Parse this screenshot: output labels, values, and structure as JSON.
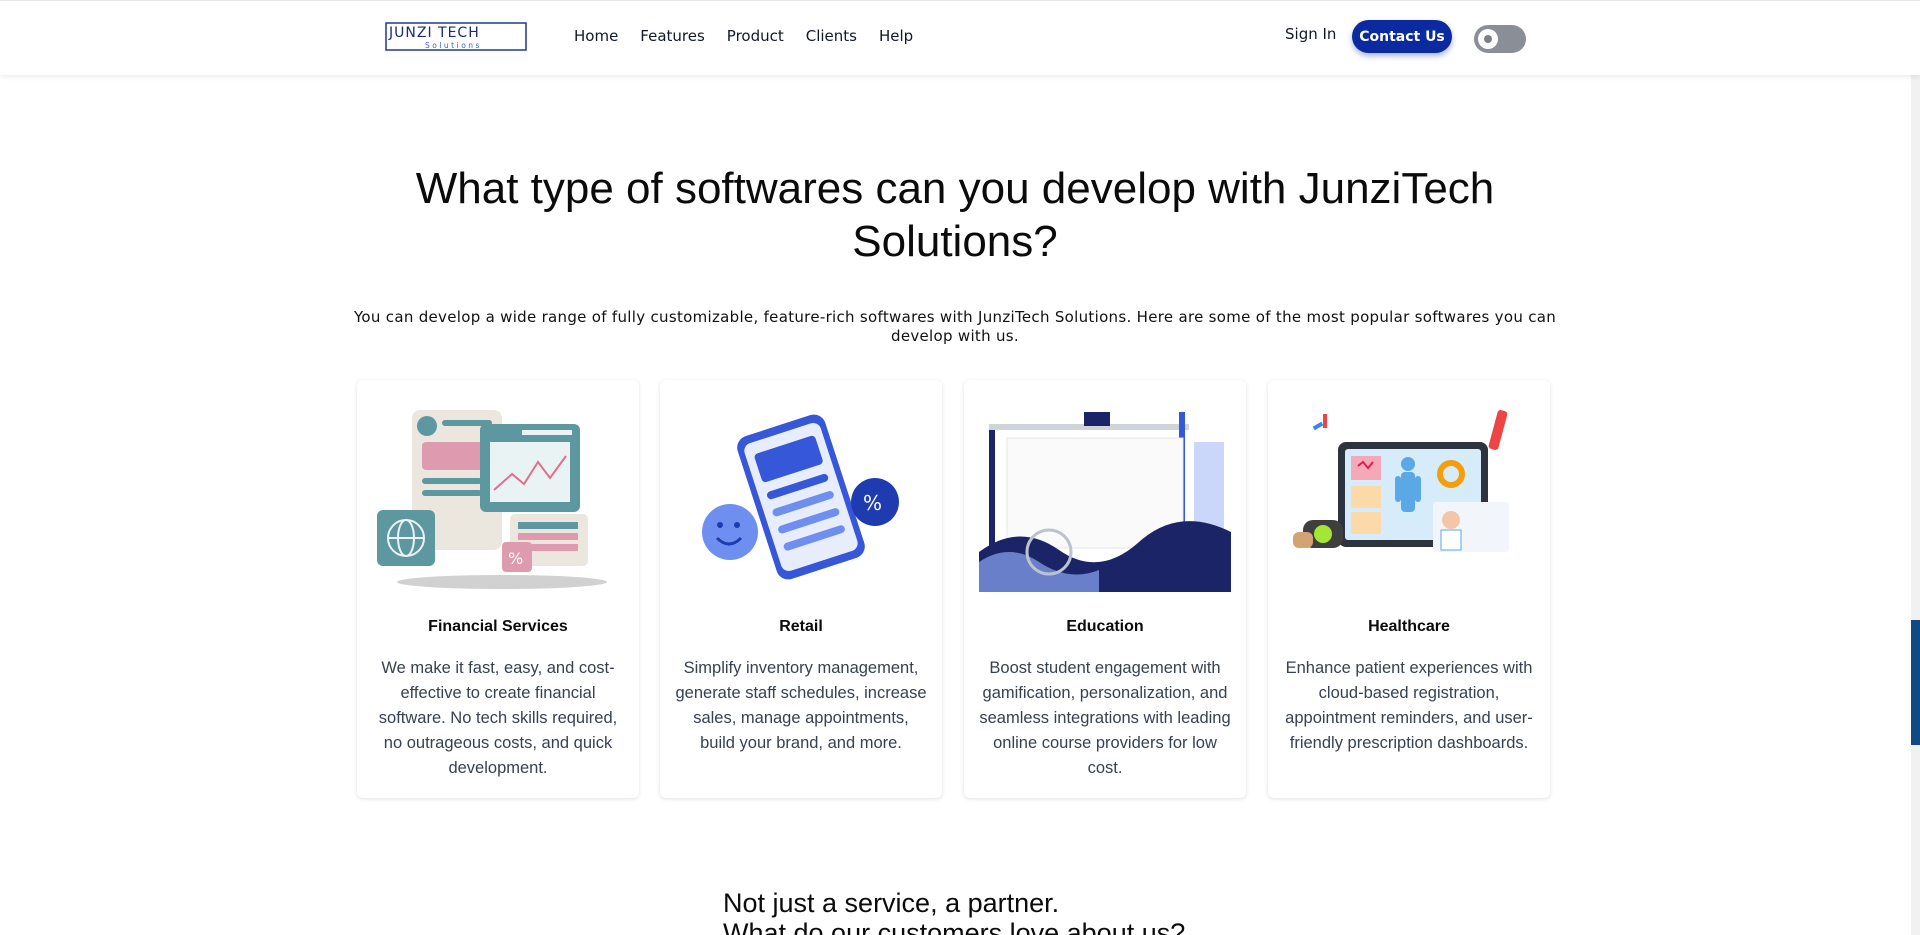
{
  "header": {
    "logo_text": "JUNZI TECH",
    "logo_subtext": "Solutions",
    "nav": [
      "Home",
      "Features",
      "Product",
      "Clients",
      "Help"
    ],
    "sign_in": "Sign In",
    "contact": "Contact Us"
  },
  "hero": {
    "title": "What type of softwares can you develop with JunziTech Solutions?",
    "subtitle": "You can develop a wide range of fully customizable, feature-rich softwares with JunziTech Solutions. Here are some of the most popular softwares you can develop with us."
  },
  "cards": [
    {
      "title": "Financial Services",
      "description": "We make it fast, easy, and cost-effective to create financial software. No tech skills required, no outrageous costs, and quick development."
    },
    {
      "title": "Retail",
      "description": "Simplify inventory management, generate staff schedules, increase sales, manage appointments, build your brand, and more."
    },
    {
      "title": "Education",
      "description": "Boost student engagement with gamification, personalization, and seamless integrations with leading online course providers for low cost."
    },
    {
      "title": "Healthcare",
      "description": "Enhance patient experiences with cloud-based registration, appointment reminders, and user-friendly prescription dashboards."
    }
  ],
  "partner": {
    "title": "Not just a service, a partner.",
    "subtitle": "What do our customers love about us?"
  },
  "colors": {
    "primary": "#0b2aa0",
    "toggle": "#8a8f97",
    "scrollbar": "#0f4a84"
  }
}
